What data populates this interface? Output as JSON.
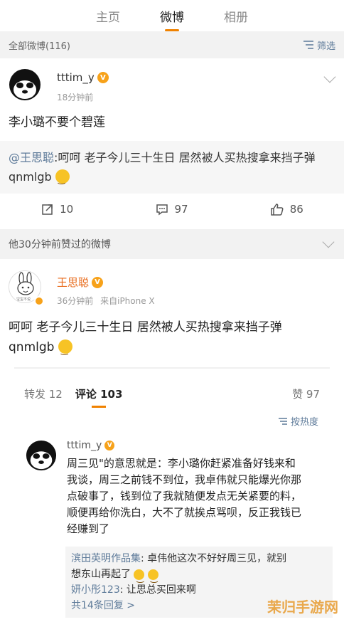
{
  "tabs": [
    {
      "label": "主页"
    },
    {
      "label": "微博"
    },
    {
      "label": "相册"
    }
  ],
  "feed_bar": {
    "label": "全部微博(116)",
    "filter_label": "筛选"
  },
  "post1": {
    "username": "tttim_y",
    "time": "18分钟前",
    "text": "李小璐不要个碧莲",
    "repost_mention": "@王思聪",
    "repost_text": ":呵呵 老子今儿三十生日 居然被人买热搜拿来挡子弹 qnmlgb",
    "repost_count": "10",
    "comment_count": "97",
    "like_count": "86"
  },
  "liked_bar": {
    "label": "他30分钟前赞过的微博"
  },
  "post2": {
    "username": "王思聪",
    "time": "36分钟前",
    "source": "来自iPhone X",
    "text_line1": "呵呵 老子今儿三十生日 居然被人买热搜拿来挡子弹",
    "text_line2": "qnmlgb",
    "avatar_caption": "宝宝不说"
  },
  "comment_tabs": {
    "repost": "转发 12",
    "comment": "评论 103",
    "likes": "赞 97"
  },
  "sort_label": "按热度",
  "comment": {
    "username": "tttim_y",
    "lines": [
      "周三见\"的意思就是：李小璐你赶紧准备好钱来和",
      "我谈，周三之前钱不到位，我卓伟就只能爆光你那",
      "点破事了，钱到位了我就随便发点无关紧要的料，",
      "顺便再给你洗白，大不了就挨点骂呗，反正我钱已",
      "经赚到了"
    ],
    "replies": [
      {
        "name": "滨田英明作品集",
        "text": ": 卓伟他这次不好好周三见，就别",
        "text2": "想东山再起了"
      },
      {
        "name": "妍小彤123",
        "text": ": 让思总买回来啊"
      }
    ],
    "more": "共14条回复 >"
  },
  "watermark": "茉归手游网",
  "colors": {
    "accent": "#f08200",
    "link": "#5d7a99",
    "vip": "#f7a21a"
  }
}
